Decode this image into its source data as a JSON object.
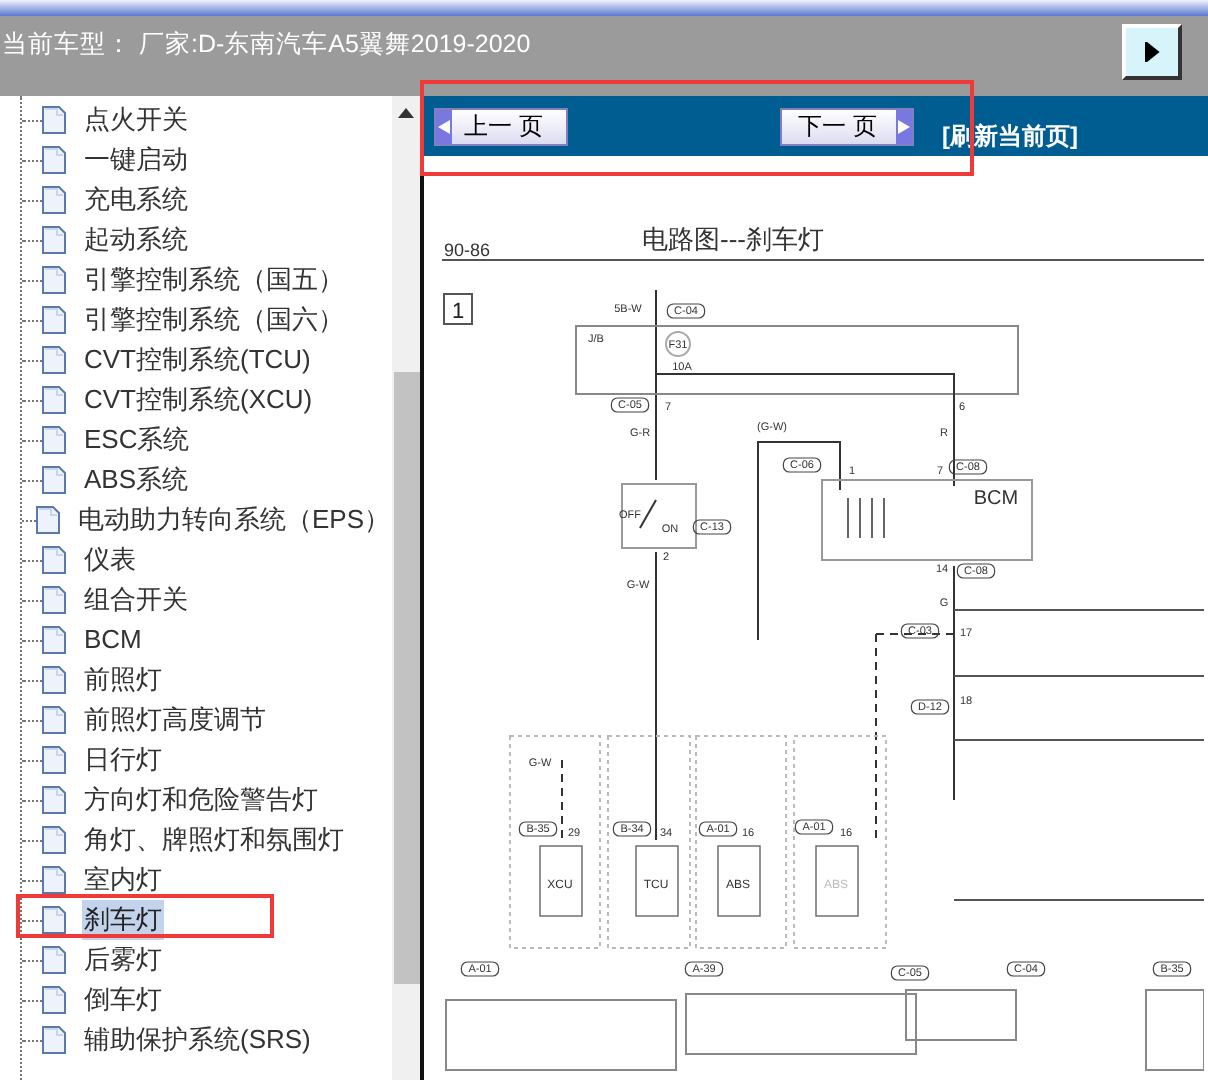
{
  "header": {
    "title": "当前车型： 厂家:D-东南汽车A5翼舞2019-2020"
  },
  "tree": {
    "items": [
      {
        "label": "点火开关",
        "selected": false
      },
      {
        "label": "一键启动",
        "selected": false
      },
      {
        "label": "充电系统",
        "selected": false
      },
      {
        "label": "起动系统",
        "selected": false
      },
      {
        "label": "引擎控制系统（国五）",
        "selected": false
      },
      {
        "label": "引擎控制系统（国六）",
        "selected": false
      },
      {
        "label": "CVT控制系统(TCU)",
        "selected": false
      },
      {
        "label": "CVT控制系统(XCU)",
        "selected": false
      },
      {
        "label": "ESC系统",
        "selected": false
      },
      {
        "label": "ABS系统",
        "selected": false
      },
      {
        "label": "电动助力转向系统（EPS）",
        "selected": false
      },
      {
        "label": "仪表",
        "selected": false
      },
      {
        "label": "组合开关",
        "selected": false
      },
      {
        "label": "BCM",
        "selected": false
      },
      {
        "label": "前照灯",
        "selected": false
      },
      {
        "label": "前照灯高度调节",
        "selected": false
      },
      {
        "label": "日行灯",
        "selected": false
      },
      {
        "label": "方向灯和危险警告灯",
        "selected": false
      },
      {
        "label": "角灯、牌照灯和氛围灯",
        "selected": false
      },
      {
        "label": "室内灯",
        "selected": false
      },
      {
        "label": "刹车灯",
        "selected": true
      },
      {
        "label": "后雾灯",
        "selected": false
      },
      {
        "label": "倒车灯",
        "selected": false
      },
      {
        "label": "辅助保护系统(SRS)",
        "selected": false
      }
    ]
  },
  "toolbar": {
    "prev": "上一 页",
    "next": "下一 页",
    "refresh": "[刷新当前页]"
  },
  "diagram": {
    "page": "90-86",
    "title": "电路图---刹车灯",
    "section": "1",
    "labels": [
      {
        "text": "5B-W",
        "kind": "plain"
      },
      {
        "text": "C-04",
        "kind": "connector"
      },
      {
        "text": "J/B",
        "kind": "plain"
      },
      {
        "text": "F31",
        "kind": "plain"
      },
      {
        "text": "10A",
        "kind": "plain"
      },
      {
        "text": "C-05",
        "kind": "connector"
      },
      {
        "text": "7",
        "kind": "plain"
      },
      {
        "text": "6",
        "kind": "plain"
      },
      {
        "text": "G-R",
        "kind": "plain"
      },
      {
        "text": "(G-W)",
        "kind": "plain"
      },
      {
        "text": "R",
        "kind": "plain"
      },
      {
        "text": "C-06",
        "kind": "connector"
      },
      {
        "text": "1",
        "kind": "plain"
      },
      {
        "text": "7",
        "kind": "plain"
      },
      {
        "text": "C-08",
        "kind": "connector"
      },
      {
        "text": "BCM",
        "kind": "large"
      },
      {
        "text": "OFF",
        "kind": "plain"
      },
      {
        "text": "ON",
        "kind": "plain"
      },
      {
        "text": "C-13",
        "kind": "connector"
      },
      {
        "text": "2",
        "kind": "plain"
      },
      {
        "text": "14",
        "kind": "plain"
      },
      {
        "text": "C-08",
        "kind": "connector"
      },
      {
        "text": "G-W",
        "kind": "plain"
      },
      {
        "text": "G",
        "kind": "plain"
      },
      {
        "text": "C-03",
        "kind": "connector"
      },
      {
        "text": "17",
        "kind": "plain"
      },
      {
        "text": "D-12",
        "kind": "connector"
      },
      {
        "text": "18",
        "kind": "plain"
      },
      {
        "text": "G-W",
        "kind": "plain"
      },
      {
        "text": "B-35",
        "kind": "connector"
      },
      {
        "text": "29",
        "kind": "plain"
      },
      {
        "text": "B-34",
        "kind": "connector"
      },
      {
        "text": "34",
        "kind": "plain"
      },
      {
        "text": "A-01",
        "kind": "connector"
      },
      {
        "text": "16",
        "kind": "plain"
      },
      {
        "text": "A-01",
        "kind": "connector"
      },
      {
        "text": "16",
        "kind": "plain"
      },
      {
        "text": "XCU",
        "kind": "module"
      },
      {
        "text": "TCU",
        "kind": "module"
      },
      {
        "text": "ABS",
        "kind": "module"
      },
      {
        "text": "ABS",
        "kind": "module"
      },
      {
        "text": "A-01",
        "kind": "connector"
      },
      {
        "text": "A-39",
        "kind": "connector"
      },
      {
        "text": "C-05",
        "kind": "connector"
      },
      {
        "text": "C-04",
        "kind": "connector"
      },
      {
        "text": "B-35",
        "kind": "connector"
      }
    ]
  }
}
